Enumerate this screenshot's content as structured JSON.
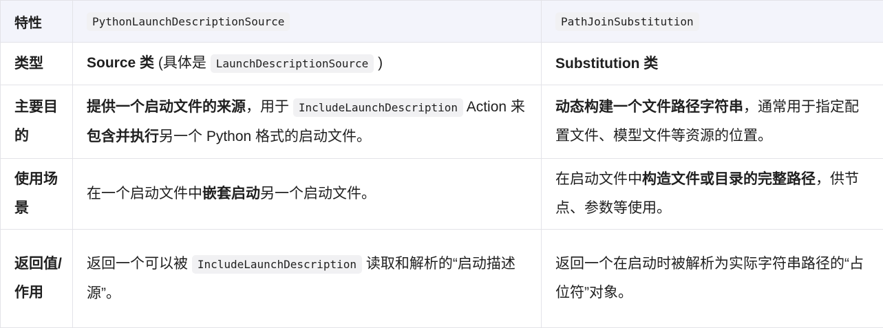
{
  "header": {
    "feature": "特性",
    "col_a": "PythonLaunchDescriptionSource",
    "col_b": "PathJoinSubstitution"
  },
  "rows": {
    "type": {
      "feature": "类型",
      "a_bold": "Source 类",
      "a_text1": " (具体是 ",
      "a_code": "LaunchDescriptionSource",
      "a_text2": " )",
      "b_bold": "Substitution 类"
    },
    "purpose": {
      "feature": "主要目的",
      "a_bold1": "提供一个启动文件的来源",
      "a_text1": "，用于 ",
      "a_code": "IncludeLaunchDescription",
      "a_text2": " Action 来",
      "a_bold2": "包含并执行",
      "a_text3": "另一个 Python 格式的启动文件。",
      "b_bold": "动态构建一个文件路径字符串",
      "b_text": "，通常用于指定配置文件、模型文件等资源的位置。"
    },
    "scenario": {
      "feature": "使用场景",
      "a_text1": "在一个启动文件中",
      "a_bold": "嵌套启动",
      "a_text2": "另一个启动文件。",
      "b_text1": "在启动文件中",
      "b_bold": "构造文件或目录的完整路径",
      "b_text2": "，供节点、参数等使用。"
    },
    "return": {
      "feature": "返回值/作用",
      "a_text1": "返回一个可以被 ",
      "a_code": "IncludeLaunchDescription",
      "a_text2": " 读取和解析的“启动描述源”。",
      "b_text": "返回一个在启动时被解析为实际字符串路径的“占位符”对象。"
    }
  }
}
